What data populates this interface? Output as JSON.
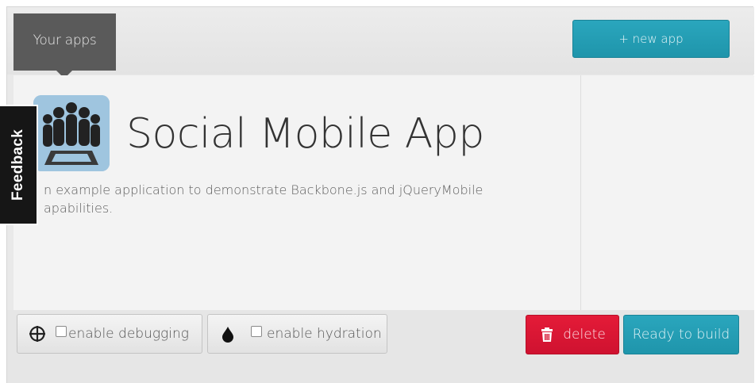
{
  "header": {
    "tab_label": "Your apps",
    "new_app_label": "+ new app"
  },
  "feedback": {
    "label": "Feedback"
  },
  "app": {
    "title": "Social Mobile App",
    "description": "n example application to demonstrate Backbone.js and jQueryMobile apabilities.",
    "icon": "people-group-icon"
  },
  "footer": {
    "debug_label": "enable debugging",
    "debug_checked": false,
    "hydration_label": "enable hydration",
    "hydration_checked": false,
    "delete_label": "delete",
    "build_label": "Ready to build"
  },
  "colors": {
    "accent_teal": "#1f95ab",
    "danger_red": "#d91534",
    "tab_dark": "#5a5a5a",
    "feedback_bg": "#161616"
  }
}
